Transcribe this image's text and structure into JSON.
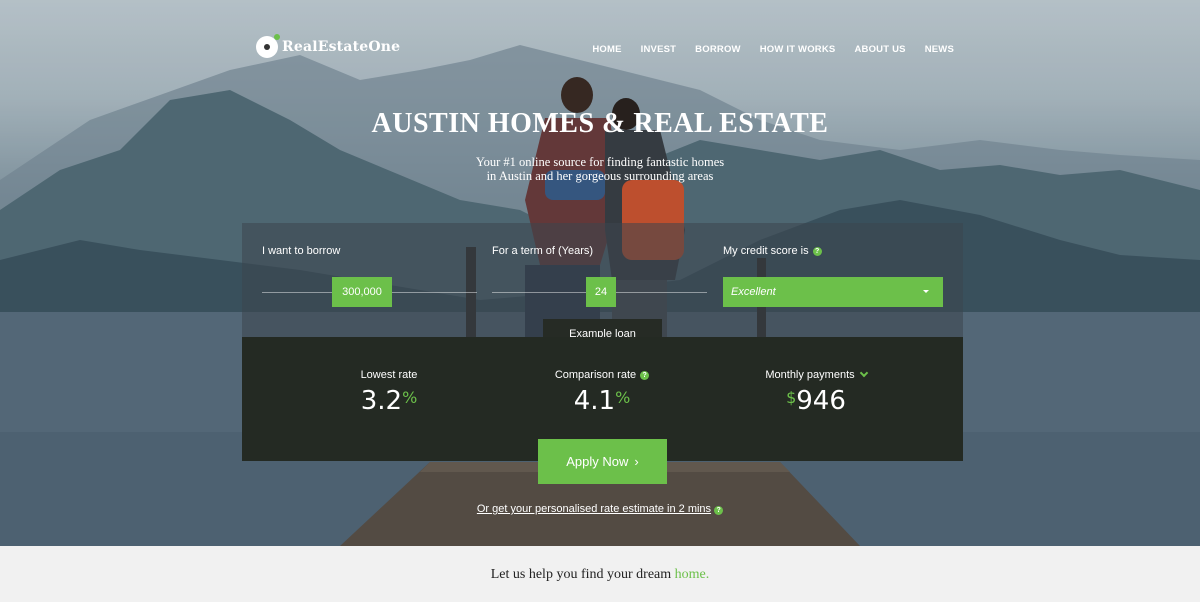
{
  "brand": {
    "name": "RealEstateOne",
    "accent": "#6cc04a"
  },
  "nav": {
    "items": [
      "HOME",
      "INVEST",
      "BORROW",
      "HOW IT WORKS",
      "ABOUT US",
      "NEWS"
    ]
  },
  "hero": {
    "title": "AUSTIN HOMES & REAL ESTATE",
    "subtitle_line1": "Your #1 online source for finding fantastic homes",
    "subtitle_line2": "in Austin and her gorgeous surrounding areas"
  },
  "calculator": {
    "borrow": {
      "label": "I want to borrow",
      "value": "300,000"
    },
    "term": {
      "label": "For a term of (Years)",
      "value": "24"
    },
    "credit": {
      "label": "My credit score is",
      "selected": "Excellent"
    },
    "example_tab": "Example loan",
    "stats": {
      "lowest": {
        "label": "Lowest rate",
        "value": "3.2",
        "unit": "%"
      },
      "comparison": {
        "label": "Comparison rate",
        "value": "4.1",
        "unit": "%"
      },
      "monthly": {
        "label": "Monthly payments",
        "currency": "$",
        "value": "946"
      }
    }
  },
  "cta": {
    "apply_label": "Apply Now",
    "apply_icon": "›",
    "estimate_link": "Or get your personalised rate estimate in 2 mins"
  },
  "footer": {
    "tagline_main": "Let us help you find your dream",
    "tagline_accent": "home."
  },
  "icons": {
    "help": "?",
    "chevron": "chevron-down-icon"
  }
}
